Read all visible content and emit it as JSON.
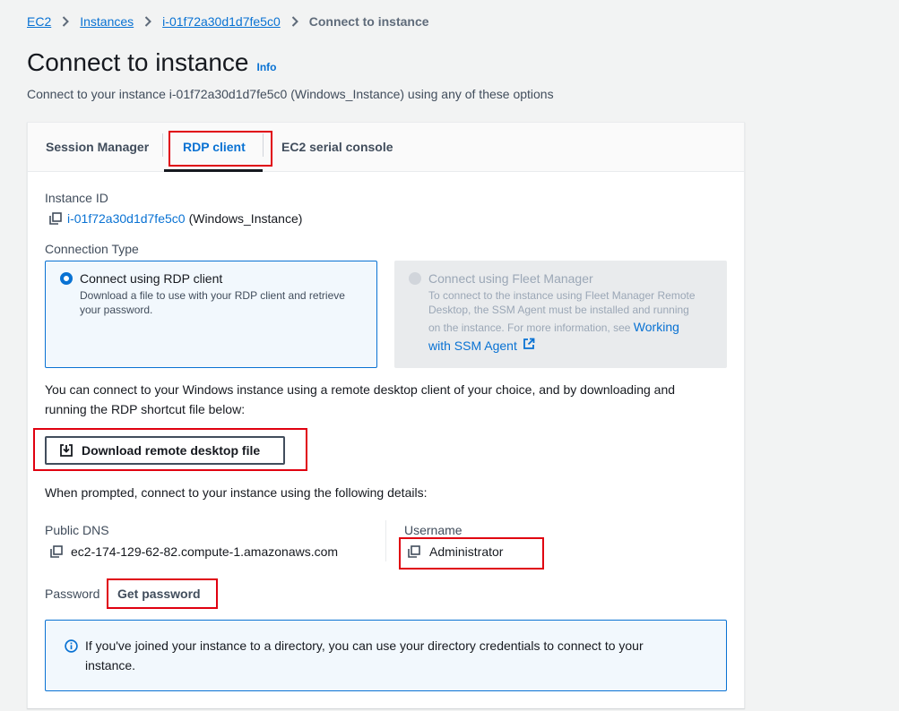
{
  "breadcrumb": {
    "items": [
      "EC2",
      "Instances",
      "i-01f72a30d1d7fe5c0"
    ],
    "current": "Connect to instance"
  },
  "page": {
    "title": "Connect to instance",
    "info_link": "Info",
    "description": "Connect to your instance i-01f72a30d1d7fe5c0 (Windows_Instance) using any of these options"
  },
  "tabs": [
    {
      "label": "Session Manager",
      "active": false
    },
    {
      "label": "RDP client",
      "active": true
    },
    {
      "label": "EC2 serial console",
      "active": false
    }
  ],
  "instance": {
    "label": "Instance ID",
    "id": "i-01f72a30d1d7fe5c0",
    "name": "(Windows_Instance)"
  },
  "connection_type": {
    "label": "Connection Type",
    "options": [
      {
        "title": "Connect using RDP client",
        "description_line1": "Download a file to use with your RDP client and retrieve",
        "description_line2": "your password.",
        "selected": true,
        "disabled": false
      },
      {
        "title": "Connect using Fleet Manager",
        "description_line1": "To connect to the instance using Fleet Manager Remote",
        "description_line2": "Desktop, the SSM Agent must be installed and running",
        "description_line3": "on the instance. For more information, see",
        "link_part1": "Working",
        "link_part2": "with SSM Agent",
        "selected": false,
        "disabled": true
      }
    ]
  },
  "rdp_intro_line1": "You can connect to your Windows instance using a remote desktop client of your choice, and by downloading and",
  "rdp_intro_line2": "running the RDP shortcut file below:",
  "download_button": "Download remote desktop file",
  "prompt_text": "When prompted, connect to your instance using the following details:",
  "details": {
    "dns_label": "Public DNS",
    "dns_value": "ec2-174-129-62-82.compute-1.amazonaws.com",
    "username_label": "Username",
    "username_value": "Administrator",
    "password_label": "Password",
    "password_action": "Get password"
  },
  "alert": {
    "line1": "If you've joined your instance to a directory, you can use your directory credentials to connect to your",
    "line2": "instance."
  },
  "colors": {
    "link": "#0972d3",
    "highlight": "#e00010",
    "text": "#16191f",
    "muted": "#414d5c",
    "disabled_text": "#9ba7b6"
  }
}
